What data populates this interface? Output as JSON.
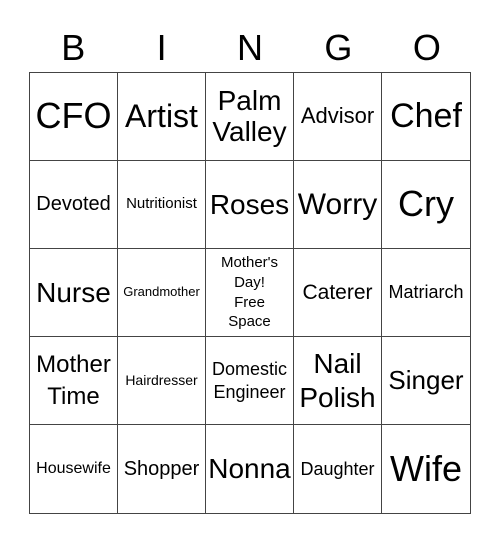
{
  "header": [
    "B",
    "I",
    "N",
    "G",
    "O"
  ],
  "cells": [
    "CFO",
    "Artist",
    "Palm\nValley",
    "Advisor",
    "Chef",
    "Devoted",
    "Nutritionist",
    "Roses",
    "Worry",
    "Cry",
    "Nurse",
    "Grandmother",
    "Mother's\nDay!\nFree\nSpace",
    "Caterer",
    "Matriarch",
    "Mother\nTime",
    "Hairdresser",
    "Domestic\nEngineer",
    "Nail\nPolish",
    "Singer",
    "Housewife",
    "Shopper",
    "Nonna",
    "Daughter",
    "Wife"
  ]
}
